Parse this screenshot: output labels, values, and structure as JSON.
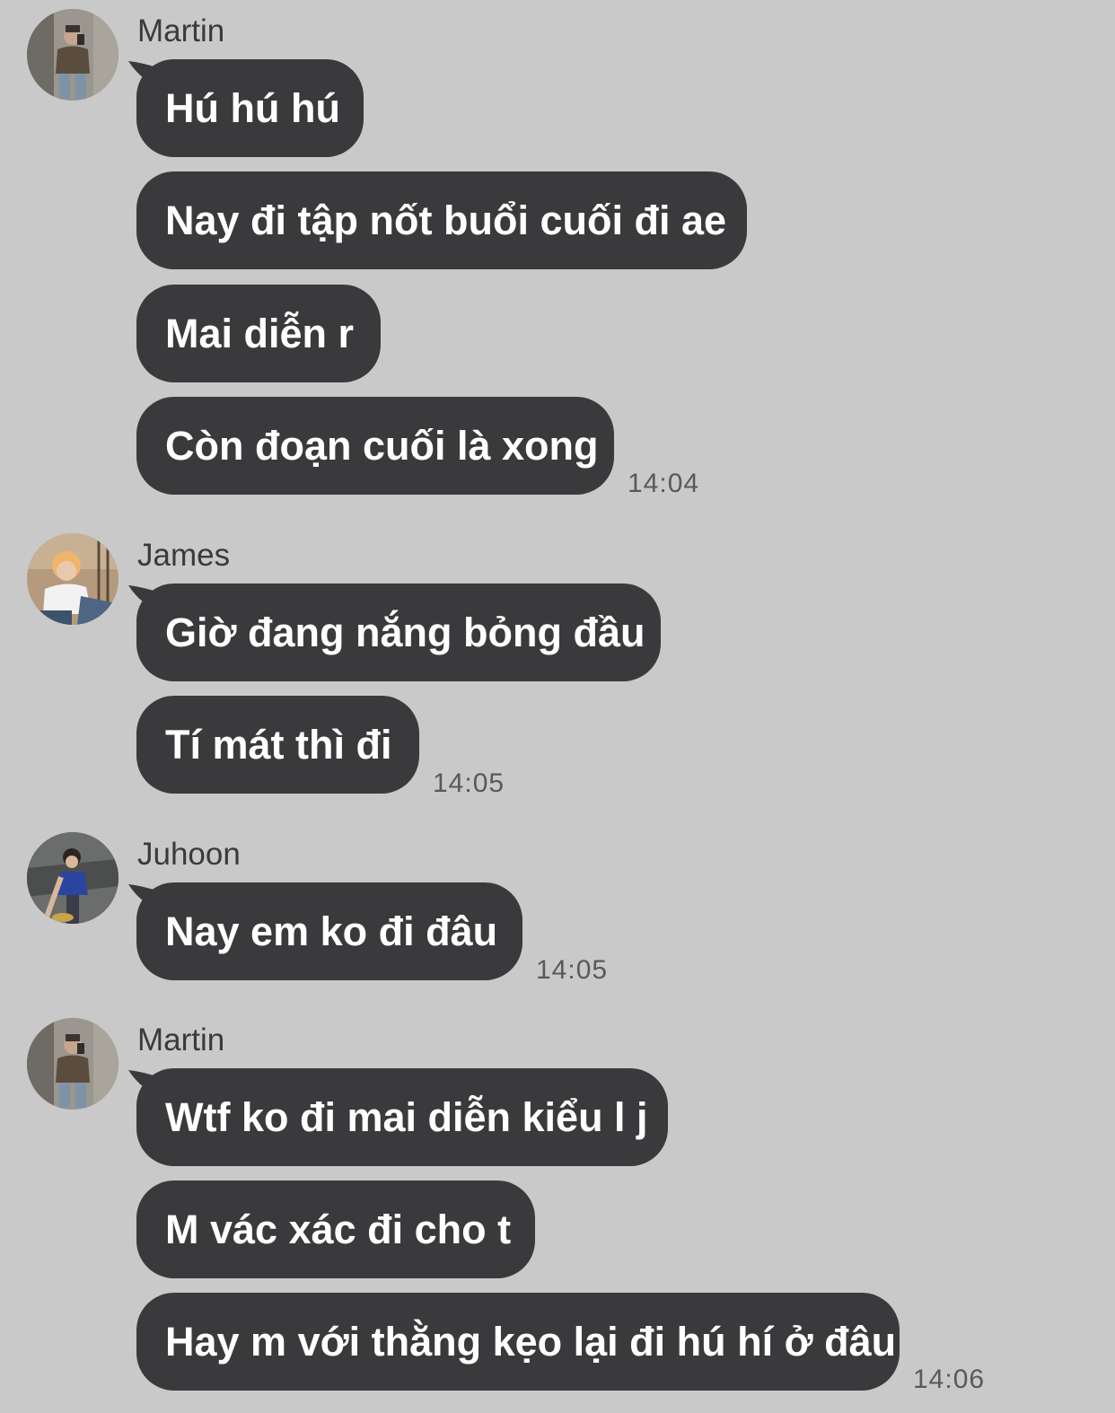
{
  "colors": {
    "background": "#c9c9c9",
    "bubble": "#3a3a3c",
    "bubble_text": "#ffffff",
    "sender_text": "#3a3a3a",
    "time_text": "#595959"
  },
  "groups": [
    {
      "sender": "Martin",
      "avatar_icon": "user-photo-avatar-icon",
      "messages": [
        "Hú hú hú",
        "Nay đi tập nốt buổi cuối đi ae",
        "Mai diễn r",
        "Còn đoạn cuối là xong"
      ],
      "time": "14:04"
    },
    {
      "sender": "James",
      "avatar_icon": "user-photo-avatar-icon",
      "messages": [
        "Giờ đang nắng bỏng đầu",
        "Tí mát thì đi"
      ],
      "time": "14:05"
    },
    {
      "sender": "Juhoon",
      "avatar_icon": "user-photo-avatar-icon",
      "messages": [
        "Nay em ko đi đâu"
      ],
      "time": "14:05"
    },
    {
      "sender": "Martin",
      "avatar_icon": "user-photo-avatar-icon",
      "messages": [
        "Wtf ko đi mai diễn kiểu l j",
        "M vác xác đi cho t",
        "Hay m với thằng kẹo lại đi hú hí ở đâu"
      ],
      "time": "14:06"
    }
  ]
}
